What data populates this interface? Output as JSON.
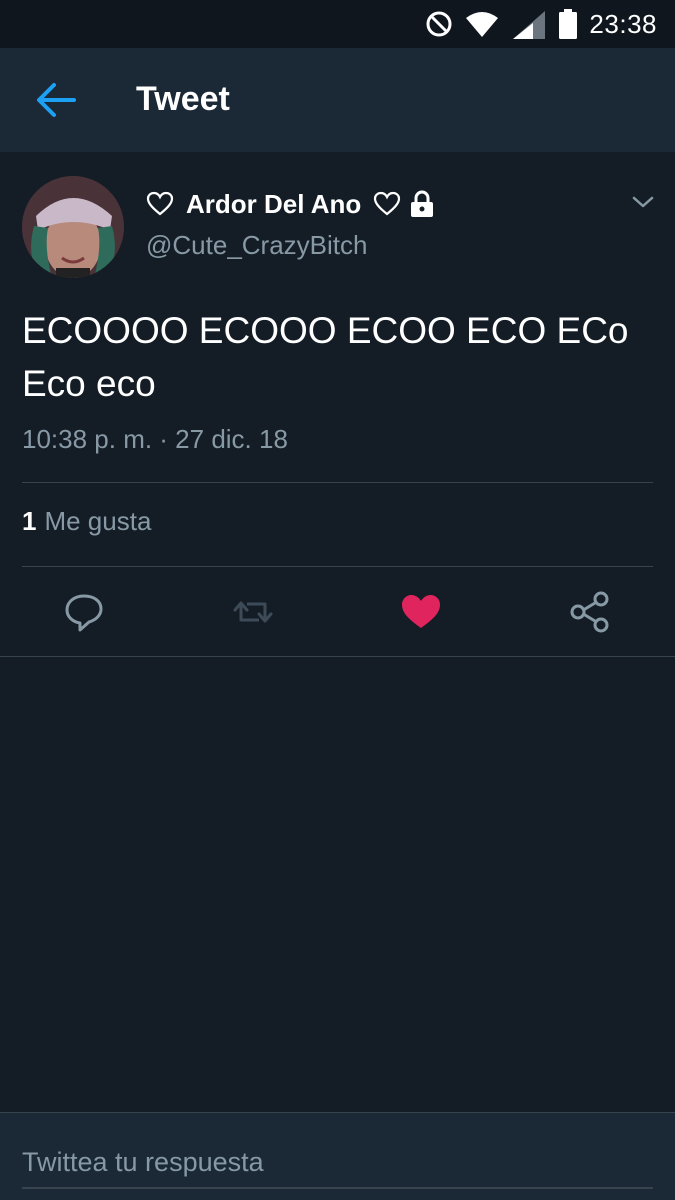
{
  "status_bar": {
    "time": "23:38",
    "icons": [
      "do-not-disturb-icon",
      "wifi-icon",
      "signal-icon",
      "battery-icon"
    ]
  },
  "app_bar": {
    "back_icon": "arrow-left-icon",
    "title": "Tweet"
  },
  "tweet": {
    "display_name": "Ardor Del Ano",
    "handle": "@Cute_CrazyBitch",
    "protected": true,
    "text": "ECOOOO ECOOO ECOO ECO ECo Eco eco",
    "timestamp": "10:38 p. m. · 27 dic. 18",
    "likes_count": "1",
    "likes_label": "Me gusta",
    "liked": true
  },
  "actions": [
    "reply-icon",
    "retweet-icon",
    "like-icon",
    "share-icon"
  ],
  "reply": {
    "placeholder": "Twittea tu respuesta"
  },
  "colors": {
    "background": "#141d26",
    "app_bar": "#1b2836",
    "accent": "#1da1f2",
    "like": "#e0245e",
    "secondary_text": "#8899a6",
    "divider": "#38444d"
  }
}
